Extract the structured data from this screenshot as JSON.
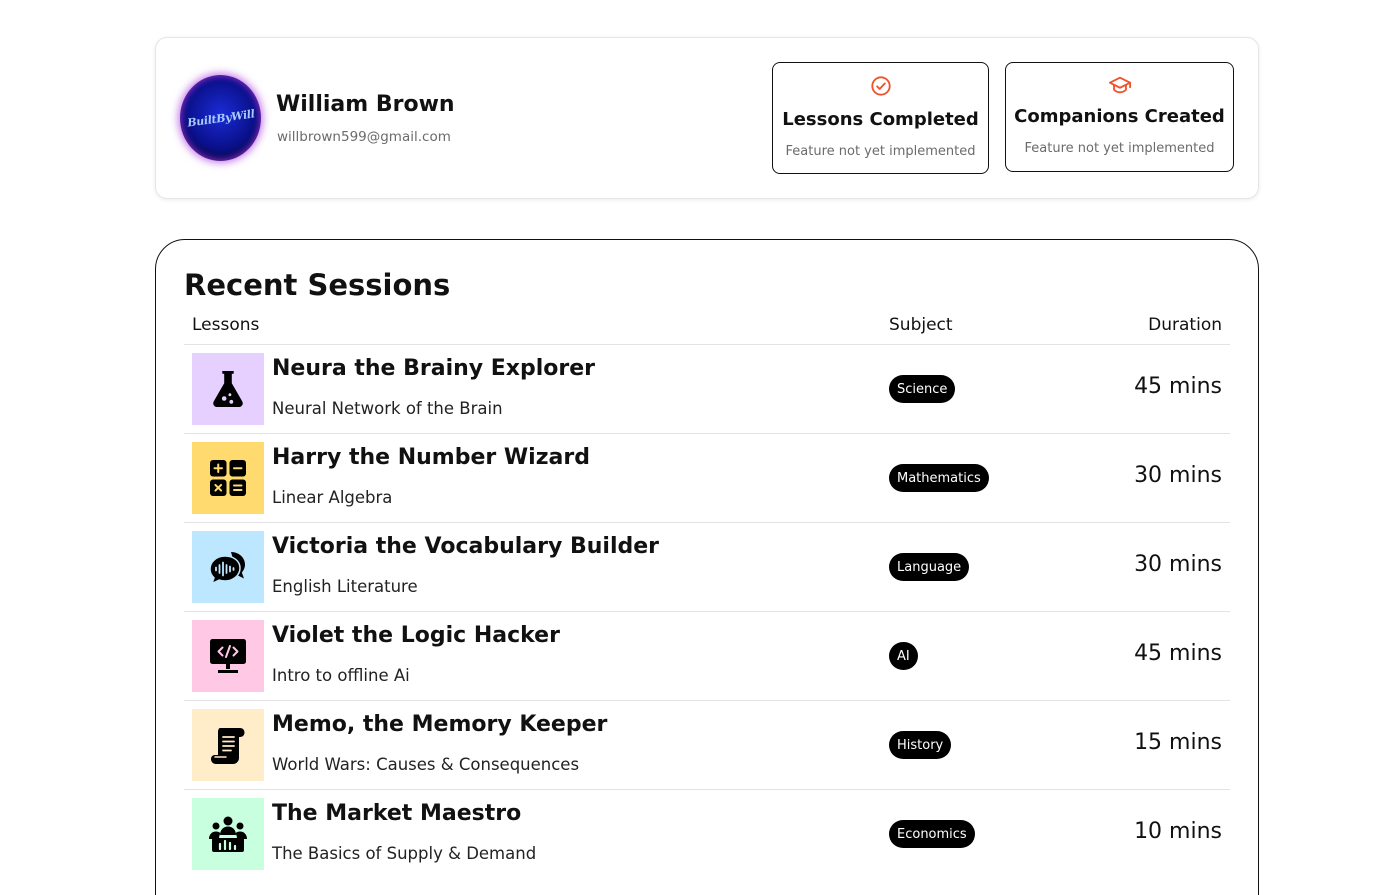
{
  "profile": {
    "avatar_text": "BuiltByWill",
    "name": "William Brown",
    "email": "willbrown599@gmail.com"
  },
  "stats": {
    "lessons": {
      "title": "Lessons Completed",
      "subtitle": "Feature not yet implemented",
      "icon": "check-circle-icon",
      "icon_color": "#f0522d"
    },
    "companions": {
      "title": "Companions Created",
      "subtitle": "Feature not yet implemented",
      "icon": "graduation-cap-icon",
      "icon_color": "#f0522d"
    }
  },
  "sessions": {
    "title": "Recent Sessions",
    "headers": {
      "lessons": "Lessons",
      "subject": "Subject",
      "duration": "Duration"
    },
    "rows": [
      {
        "name": "Neura the Brainy Explorer",
        "topic": "Neural Network of the Brain",
        "subject": "Science",
        "duration": "45 mins",
        "icon": "flask-icon",
        "color": "#e5d0ff"
      },
      {
        "name": "Harry the Number Wizard",
        "topic": "Linear Algebra",
        "subject": "Mathematics",
        "duration": "30 mins",
        "icon": "calculator-icon",
        "color": "#ffda6e"
      },
      {
        "name": "Victoria the Vocabulary Builder",
        "topic": "English Literature",
        "subject": "Language",
        "duration": "30 mins",
        "icon": "speech-bubbles-icon",
        "color": "#bde7ff"
      },
      {
        "name": "Violet the Logic Hacker",
        "topic": "Intro to offline Ai",
        "subject": "AI",
        "duration": "45 mins",
        "icon": "code-monitor-icon",
        "color": "#ffc8e4"
      },
      {
        "name": "Memo, the Memory Keeper",
        "topic": "World Wars: Causes & Consequences",
        "subject": "History",
        "duration": "15 mins",
        "icon": "scroll-icon",
        "color": "#ffecc8"
      },
      {
        "name": "The Market Maestro",
        "topic": "The Basics of Supply & Demand",
        "subject": "Economics",
        "duration": "10 mins",
        "icon": "market-people-icon",
        "color": "#c8ffdf"
      }
    ]
  }
}
